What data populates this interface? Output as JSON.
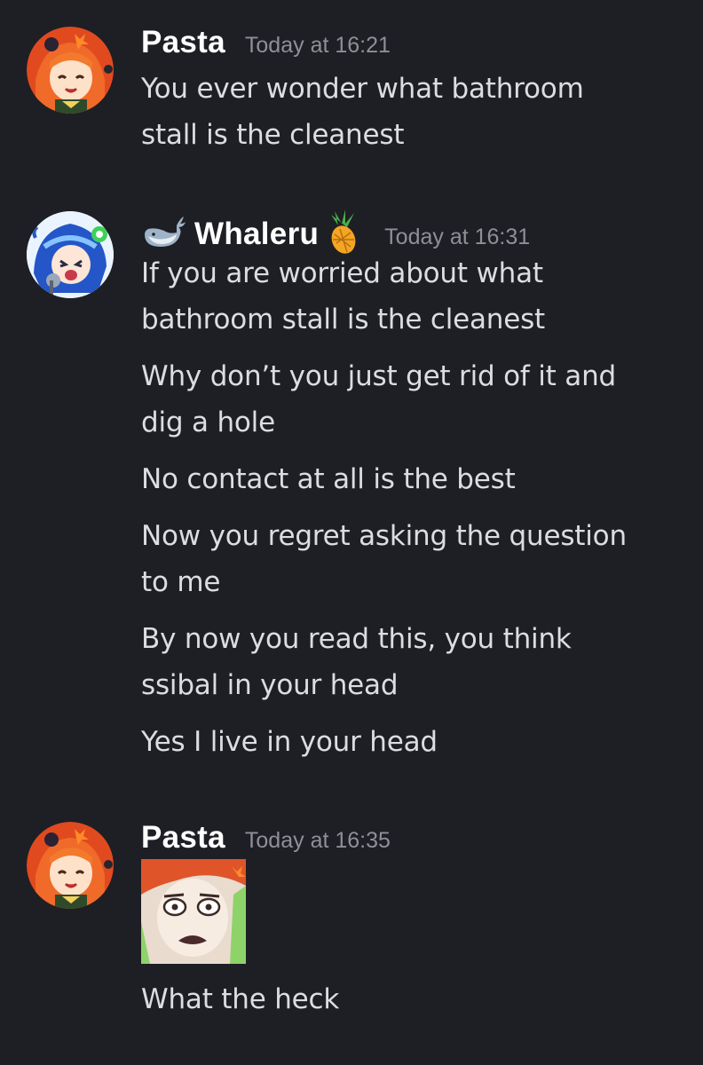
{
  "messages": [
    {
      "author": "Pasta",
      "timestamp": "Today at 16:21",
      "avatar_icon": "pasta-avatar-icon",
      "lines": [
        "You ever wonder what bathroom",
        "stall is the cleanest"
      ]
    },
    {
      "author": "Whaleru",
      "timestamp": "Today at 16:31",
      "avatar_icon": "whaleru-avatar-icon",
      "name_prefix_icon": "whale-icon",
      "name_suffix_icon": "pineapple-icon",
      "lines": [
        "If you are worried about what",
        "bathroom stall is the cleanest",
        "Why don’t you just get rid of it and",
        "dig a hole",
        "No contact at all is the best",
        "Now you regret asking the question",
        "to me",
        "By now you read this, you think",
        "ssibal in your head",
        "Yes I live in your head"
      ]
    },
    {
      "author": "Pasta",
      "timestamp": "Today at 16:35",
      "avatar_icon": "pasta-avatar-icon",
      "attachment_icon": "shocked-face-sticker-icon",
      "lines": [
        "What the heck"
      ]
    }
  ],
  "colors": {
    "background": "#1e1f24",
    "username": "#ffffff",
    "timestamp": "#8e9097",
    "message_text": "#dcdde1"
  }
}
